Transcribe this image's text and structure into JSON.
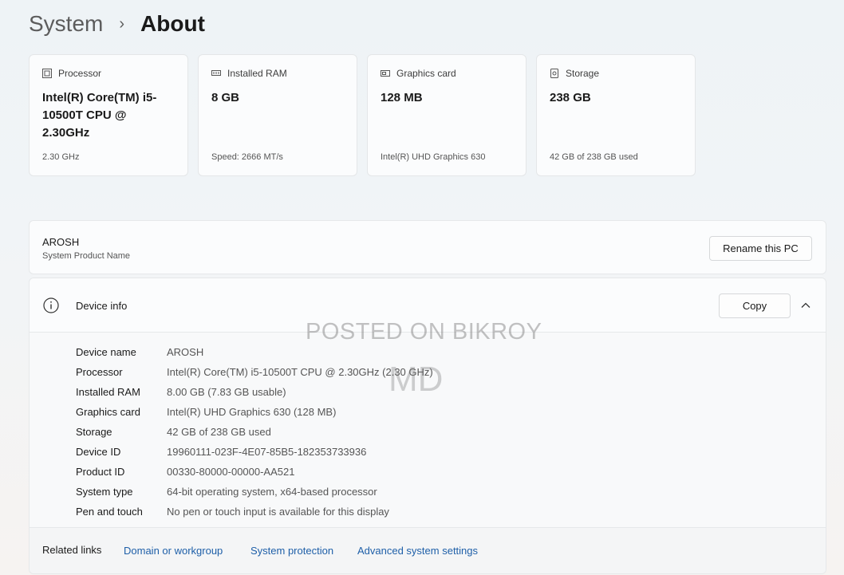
{
  "breadcrumb": {
    "parent": "System",
    "separator": "›",
    "current": "About"
  },
  "cards": [
    {
      "icon": "processor-icon",
      "label": "Processor",
      "value": "Intel(R) Core(TM) i5-10500T CPU @ 2.30GHz",
      "sub": "2.30 GHz"
    },
    {
      "icon": "ram-icon",
      "label": "Installed RAM",
      "value": "8 GB",
      "sub": "Speed: 2666 MT/s"
    },
    {
      "icon": "graphics-card-icon",
      "label": "Graphics card",
      "value": "128 MB",
      "sub": "Intel(R) UHD Graphics 630"
    },
    {
      "icon": "storage-icon",
      "label": "Storage",
      "value": "238 GB",
      "sub": "42 GB of 238 GB used"
    }
  ],
  "pc": {
    "name": "AROSH",
    "sub": "System Product Name",
    "rename_label": "Rename this PC"
  },
  "device_info": {
    "title": "Device info",
    "copy_label": "Copy",
    "specs": [
      {
        "label": "Device name",
        "value": "AROSH"
      },
      {
        "label": "Processor",
        "value": "Intel(R) Core(TM) i5-10500T CPU @ 2.30GHz (2.30 GHz)"
      },
      {
        "label": "Installed RAM",
        "value": "8.00 GB (7.83 GB usable)"
      },
      {
        "label": "Graphics card",
        "value": "Intel(R) UHD Graphics 630 (128 MB)"
      },
      {
        "label": "Storage",
        "value": "42 GB of 238 GB used"
      },
      {
        "label": "Device ID",
        "value": "19960111-023F-4E07-85B5-182353733936"
      },
      {
        "label": "Product ID",
        "value": "00330-80000-00000-AA521"
      },
      {
        "label": "System type",
        "value": "64-bit operating system, x64-based processor"
      },
      {
        "label": "Pen and touch",
        "value": "No pen or touch input is available for this display"
      }
    ]
  },
  "related": {
    "label": "Related links",
    "links": [
      "Domain or workgroup",
      "System protection",
      "Advanced system settings"
    ]
  },
  "watermark": {
    "line1": "POSTED ON BIKROY",
    "line2": "MD"
  },
  "colors": {
    "link": "#1e5fa8",
    "panel": "#fbfcfd",
    "background": "#eef3f6"
  }
}
